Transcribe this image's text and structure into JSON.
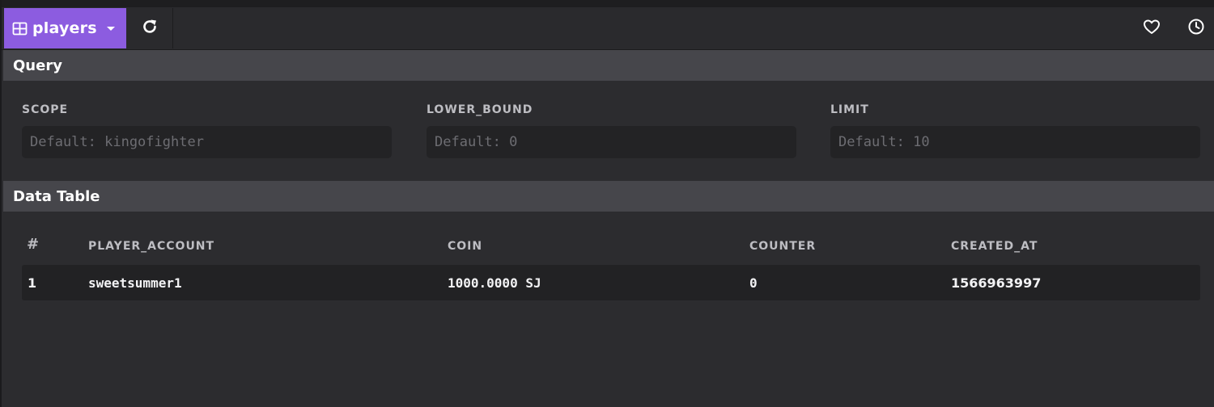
{
  "toolbar": {
    "table_name": "players",
    "table_icon": "table-grid-icon",
    "refresh_icon": "refresh-icon",
    "favorite_icon": "heart-icon",
    "history_icon": "clock-icon",
    "accent_color": "#8c5ce0"
  },
  "query": {
    "title": "Query",
    "fields": [
      {
        "label": "SCOPE",
        "value": "",
        "placeholder": "Default: kingofighter"
      },
      {
        "label": "LOWER_BOUND",
        "value": "",
        "placeholder": "Default: 0"
      },
      {
        "label": "LIMIT",
        "value": "",
        "placeholder": "Default: 10"
      }
    ]
  },
  "data_table": {
    "title": "Data Table",
    "columns": [
      "#",
      "PLAYER_ACCOUNT",
      "COIN",
      "COUNTER",
      "CREATED_AT"
    ],
    "rows": [
      [
        "1",
        "sweetsummer1",
        "1000.0000 SJ",
        "0",
        "1566963997"
      ]
    ]
  }
}
